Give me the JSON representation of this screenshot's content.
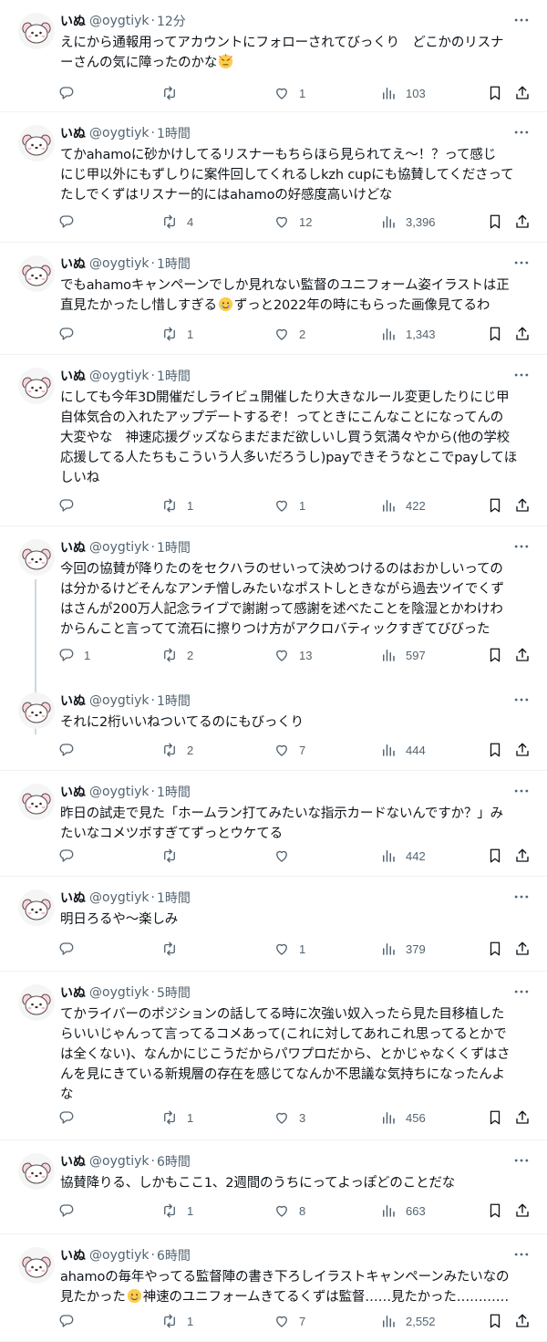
{
  "tweets": [
    {
      "name": "いぬ",
      "handle": "@oygtiyk",
      "time": "12分",
      "lines": [
        "えにから通報用ってアカウントにフォローされてびっくり　どこかのリスナ",
        "ーさんの気に障ったのかな"
      ],
      "emoji_after": "sweat-emoji",
      "replies": "",
      "retweets": "",
      "likes": "1",
      "views": "103"
    },
    {
      "name": "いぬ",
      "handle": "@oygtiyk",
      "time": "1時間",
      "lines": [
        "てかahamoに砂かけしてるリスナーもちらほら見られてえ〜！？って感じ",
        "にじ甲以外にもずしりに案件回してくれるしkzh cupにも協賛してくださって",
        "たしでくずはリスナー的にはahamoの好感度高いけどな"
      ],
      "replies": "",
      "retweets": "4",
      "likes": "12",
      "views": "3,396"
    },
    {
      "name": "いぬ",
      "handle": "@oygtiyk",
      "time": "1時間",
      "lines": [
        "でもahamoキャンペーンでしか見れない監督のユニフォーム姿イラストは正",
        "直見たかったし惜しすぎる[E]ずっと2022年の時にもらった画像見てるわ"
      ],
      "emoji_mid": "crying-emoji",
      "replies": "",
      "retweets": "1",
      "likes": "2",
      "views": "1,343"
    },
    {
      "name": "いぬ",
      "handle": "@oygtiyk",
      "time": "1時間",
      "lines": [
        "にしても今年3D開催だしライビュ開催したり大きなルール変更したりにじ甲",
        "自体気合の入れたアップデートするぞ！ってときにこんなことになってんの",
        "大変やな　神速応援グッズならまだまだ欲しいし買う気満々やから(他の学校",
        "応援してる人たちもこういう人多いだろうし)payできそうなとこでpayしてほ",
        "しいね"
      ],
      "replies": "",
      "retweets": "1",
      "likes": "1",
      "views": "422"
    },
    {
      "name": "いぬ",
      "handle": "@oygtiyk",
      "time": "1時間",
      "lines": [
        "今回の協賛が降りたのをセクハラのせいって決めつけるのはおかしいっての",
        "は分かるけどそんなアンチ憎しみたいなポストしときながら過去ツイでくず",
        "はさんが200万人記念ライブで謝謝って感謝を述べたことを陰湿とかわけわ",
        "からんこと言ってて流石に擦りつけ方がアクロバティックすぎてびびった"
      ],
      "replies": "1",
      "retweets": "2",
      "likes": "13",
      "views": "597"
    },
    {
      "name": "いぬ",
      "handle": "@oygtiyk",
      "time": "1時間",
      "lines": [
        "それに2桁いいねついてるのにもびっくり"
      ],
      "replies": "",
      "retweets": "2",
      "likes": "7",
      "views": "444"
    },
    {
      "name": "いぬ",
      "handle": "@oygtiyk",
      "time": "1時間",
      "lines": [
        "昨日の試走で見た「ホームラン打てみたいな指示カードないんですか？」み",
        "たいなコメツボすぎてずっとウケてる"
      ],
      "replies": "",
      "retweets": "",
      "likes": "",
      "views": "442"
    },
    {
      "name": "いぬ",
      "handle": "@oygtiyk",
      "time": "1時間",
      "lines": [
        "明日ろるや〜楽しみ"
      ],
      "replies": "",
      "retweets": "",
      "likes": "1",
      "views": "379"
    },
    {
      "name": "いぬ",
      "handle": "@oygtiyk",
      "time": "5時間",
      "lines": [
        "てかライバーのポジションの話してる時に次強い奴入ったら見た目移植した",
        "らいいじゃんって言ってるコメあって(これに対してあれこれ思ってるとかで",
        "は全くない)、なんかにじこうだからパワプロだから、とかじゃなくくずはさ",
        "んを見にきている新規層の存在を感じてなんか不思議な気持ちになったんよ",
        "な"
      ],
      "replies": "",
      "retweets": "1",
      "likes": "3",
      "views": "456"
    },
    {
      "name": "いぬ",
      "handle": "@oygtiyk",
      "time": "6時間",
      "lines": [
        "協賛降りる、しかもここ1、2週間のうちにってよっぽどのことだな"
      ],
      "replies": "",
      "retweets": "1",
      "likes": "8",
      "views": "663"
    },
    {
      "name": "いぬ",
      "handle": "@oygtiyk",
      "time": "6時間",
      "lines": [
        "ahamoの毎年やってる監督陣の書き下ろしイラストキャンペーンみたいなの",
        "見たかった[E]神速のユニフォームきてるくずは監督……見たかった…………"
      ],
      "emoji_mid": "crying-emoji",
      "replies": "",
      "retweets": "1",
      "likes": "7",
      "views": "2,552"
    }
  ],
  "colors": {
    "text": "#0f1419",
    "secondary": "#536471",
    "divider": "#eff3f4",
    "thread_line": "#cfd9de"
  },
  "icons": [
    "reply-icon",
    "retweet-icon",
    "like-icon",
    "views-icon",
    "bookmark-icon",
    "share-icon",
    "more-icon"
  ]
}
